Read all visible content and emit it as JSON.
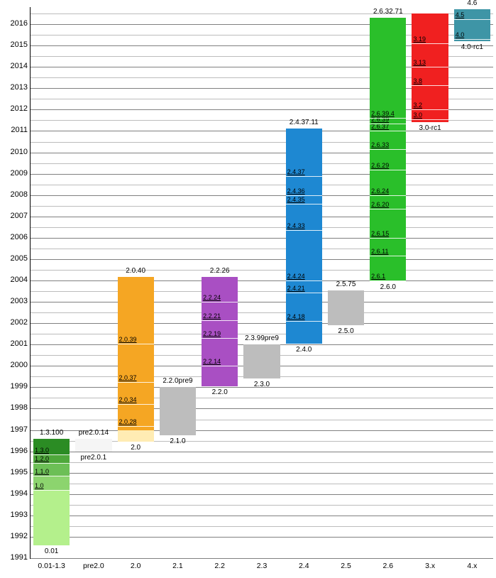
{
  "chart_data": {
    "type": "timeline-bar",
    "title": "",
    "y_axis": {
      "min": 1991,
      "max": 2016.8,
      "ticks": [
        1991,
        1992,
        1993,
        1994,
        1995,
        1996,
        1997,
        1998,
        1999,
        2000,
        2001,
        2002,
        2003,
        2004,
        2005,
        2006,
        2007,
        2008,
        2009,
        2010,
        2011,
        2012,
        2013,
        2014,
        2015,
        2016
      ]
    },
    "categories": [
      "0.01-1.3",
      "pre2.0",
      "2.0",
      "2.1",
      "2.2",
      "2.3",
      "2.4",
      "2.5",
      "2.6",
      "3.x",
      "4.x"
    ],
    "columns": [
      {
        "name": "0.01-1.3",
        "bars": [
          {
            "y0": 1991.6,
            "y1": 1994.2,
            "color": "#b4f08c",
            "markers": []
          },
          {
            "y0": 1994.2,
            "y1": 1994.85,
            "color": "#8cd46e",
            "markers": [
              {
                "y": 1994.2,
                "label": "1.0"
              }
            ]
          },
          {
            "y0": 1994.85,
            "y1": 1995.45,
            "color": "#6cbf56",
            "markers": [
              {
                "y": 1994.85,
                "label": "1.1.0"
              }
            ]
          },
          {
            "y0": 1995.45,
            "y1": 1995.85,
            "color": "#4EA83B",
            "markers": [
              {
                "y": 1995.45,
                "label": "1.2.0"
              }
            ]
          },
          {
            "y0": 1995.85,
            "y1": 1996.6,
            "color": "#2B8C24",
            "markers": [
              {
                "y": 1995.85,
                "label": "1.3.0"
              }
            ],
            "topLabel": "1.3.100"
          }
        ],
        "bottomLabel": "0.01"
      },
      {
        "name": "pre2.0",
        "bars": [
          {
            "y0": 1996.0,
            "y1": 1996.6,
            "color": "#f5f5f5",
            "bottomLabel": "pre2.0.1",
            "topLabel": "pre2.0.14"
          }
        ]
      },
      {
        "name": "2.0",
        "bars": [
          {
            "y0": 1996.45,
            "y1": 1997.0,
            "color": "#FFECB3"
          },
          {
            "y0": 1997.0,
            "y1": 2004.15,
            "color": "#F5A623",
            "markers": [
              {
                "y": 1997.2,
                "label": "2.0.28"
              },
              {
                "y": 1998.2,
                "label": "2.0.34"
              },
              {
                "y": 1999.25,
                "label": "2.0.37"
              },
              {
                "y": 2001.05,
                "label": "2.0.39"
              }
            ],
            "topLabel": "2.0.40"
          }
        ],
        "bottomLabel": "2.0"
      },
      {
        "name": "2.1",
        "bars": [
          {
            "y0": 1996.75,
            "y1": 1999.0,
            "color": "#bdbdbd",
            "topLabel": "2.2.0pre9",
            "bottomLabel": "2.1.0"
          }
        ]
      },
      {
        "name": "2.2",
        "bars": [
          {
            "y0": 1999.05,
            "y1": 2004.15,
            "color": "#A94FC3",
            "markers": [
              {
                "y": 2000.0,
                "label": "2.2.14"
              },
              {
                "y": 2001.3,
                "label": "2.2.19"
              },
              {
                "y": 2002.15,
                "label": "2.2.21"
              },
              {
                "y": 2003.0,
                "label": "2.2.24"
              }
            ],
            "topLabel": "2.2.26",
            "bottomLabel": "2.2.0"
          }
        ]
      },
      {
        "name": "2.3",
        "bars": [
          {
            "y0": 1999.4,
            "y1": 2001.0,
            "color": "#bdbdbd",
            "topLabel": "2.3.99pre9",
            "bottomLabel": "2.3.0"
          }
        ]
      },
      {
        "name": "2.4",
        "bars": [
          {
            "y0": 2001.05,
            "y1": 2011.1,
            "color": "#1E88D2",
            "markers": [
              {
                "y": 2002.1,
                "label": "2.4.18"
              },
              {
                "y": 2003.45,
                "label": "2.4.21"
              },
              {
                "y": 2004.0,
                "label": "2.4.24"
              },
              {
                "y": 2006.35,
                "label": "2.4.33"
              },
              {
                "y": 2007.6,
                "label": "2.4.35"
              },
              {
                "y": 2008.0,
                "label": "2.4.36"
              },
              {
                "y": 2008.9,
                "label": "2.4.37"
              }
            ],
            "topLabel": "2.4.37.11",
            "bottomLabel": "2.4.0"
          }
        ]
      },
      {
        "name": "2.5",
        "bars": [
          {
            "y0": 2001.9,
            "y1": 2003.55,
            "color": "#bdbdbd",
            "topLabel": "2.5.75",
            "bottomLabel": "2.5.0"
          }
        ]
      },
      {
        "name": "2.6",
        "bars": [
          {
            "y0": 2003.95,
            "y1": 2016.3,
            "color": "#2ABF2A",
            "markers": [
              {
                "y": 2004.0,
                "label": "2.6.1"
              },
              {
                "y": 2005.15,
                "label": "2.6.11"
              },
              {
                "y": 2006.0,
                "label": "2.6.15"
              },
              {
                "y": 2007.35,
                "label": "2.6.20"
              },
              {
                "y": 2008.0,
                "label": "2.6.24"
              },
              {
                "y": 2009.2,
                "label": "2.6.29"
              },
              {
                "y": 2010.15,
                "label": "2.6.33"
              },
              {
                "y": 2011.0,
                "label": "2.6.37"
              },
              {
                "y": 2011.35,
                "label": "2.6.39"
              },
              {
                "y": 2011.6,
                "label": "2.6.39.4"
              }
            ],
            "topLabel": "2.6.32.71",
            "bottomLabel": "2.6.0"
          }
        ]
      },
      {
        "name": "3.x",
        "bars": [
          {
            "y0": 2011.4,
            "y1": 2016.5,
            "color": "#F02020",
            "markers": [
              {
                "y": 2011.55,
                "label": "3.0"
              },
              {
                "y": 2012.0,
                "label": "3.2"
              },
              {
                "y": 2013.15,
                "label": "3.8"
              },
              {
                "y": 2014.0,
                "label": "3.13"
              },
              {
                "y": 2015.1,
                "label": "3.19"
              }
            ],
            "bottomLabel": "3.0-rc1"
          }
        ]
      },
      {
        "name": "4.x",
        "bars": [
          {
            "y0": 2015.2,
            "y1": 2016.7,
            "color": "#3E95A6",
            "markers": [
              {
                "y": 2015.3,
                "label": "4.0"
              },
              {
                "y": 2016.25,
                "label": "4.5"
              }
            ],
            "topLabel": "4.6",
            "bottomLabel": "4.0-rc1"
          }
        ]
      }
    ]
  }
}
